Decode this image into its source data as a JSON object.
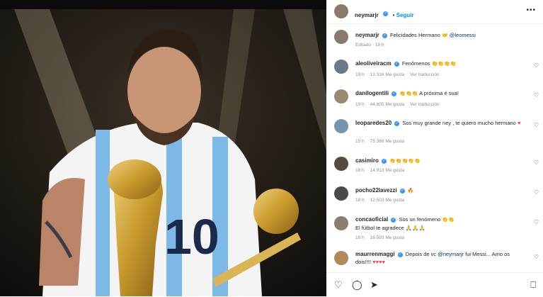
{
  "post": {
    "author": "neymarjr",
    "follow_label": "Seguir",
    "more_label": "•••",
    "caption_text": "Felicidades Hermano",
    "caption_mention": "@leomessi",
    "edited_label": "Editado · 19 h"
  },
  "comments": [
    {
      "user": "aleoliveiracm",
      "text": "Fenômenos",
      "emoji": "👏👏👏👏",
      "time": "19 h",
      "likes": "13.316 Me gusta",
      "extra": "Ver traducción"
    },
    {
      "user": "danilogentili",
      "text": "",
      "emoji": "👏👏👏",
      "text2": "A próxima é sua!",
      "time": "19 h",
      "likes": "44.605 Me gusta",
      "extra": "Ver traducción"
    },
    {
      "user": "leoparedes20",
      "text": "Sos muy grande ney , te quiero mucho hermano",
      "emoji": "♥",
      "time": "15 h",
      "likes": "75.366 Me gusta",
      "extra": ""
    },
    {
      "user": "casimiro",
      "text": "",
      "emoji": "👏👏👏👏👏",
      "time": "18 h",
      "likes": "14.913 Me gusta",
      "extra": ""
    },
    {
      "user": "pocho22lavezzi",
      "text": "",
      "emoji": "🔥",
      "time": "18 h",
      "likes": "12.503 Me gusta",
      "extra": ""
    },
    {
      "user": "concaoficial",
      "text": "Sos un fenómeno",
      "emoji": "👏👏",
      "text2": "El fútbol te agradece 🙏🙏🙏",
      "time": "18 h",
      "likes": "16.593 Me gusta",
      "extra": ""
    },
    {
      "user": "maurrenmaggi",
      "text": "Depois de vc",
      "mention": "@neymarjr",
      "text3": "fui Messi... Amo os dois!!!!",
      "emoji": "♥♥♥♥",
      "time": "",
      "likes": "",
      "extra": ""
    }
  ],
  "footer": {
    "icons": [
      "heart-icon",
      "comment-icon",
      "share-icon",
      "save-icon"
    ]
  },
  "photo": {
    "shirt_number": "10"
  }
}
